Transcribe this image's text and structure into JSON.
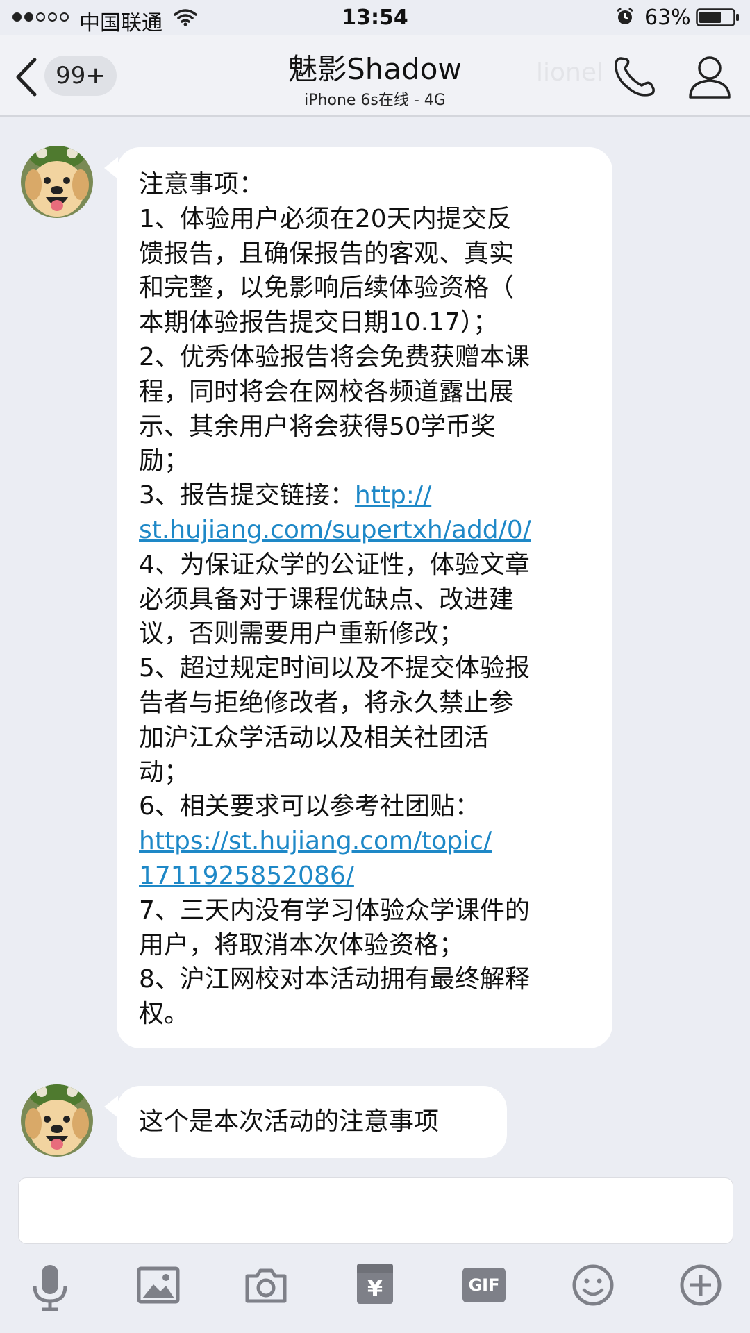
{
  "status_bar": {
    "carrier": "中国联通",
    "time": "13:54",
    "battery": "63%"
  },
  "nav": {
    "unread_count": "99+",
    "title": "魅影Shadow",
    "subtitle": "iPhone 6s在线 - 4G",
    "watermark": "lionel"
  },
  "messages": [
    {
      "lines": [
        {
          "text": "注意事项："
        },
        {
          "text": "1、体验用户必须在20天内提交反"
        },
        {
          "text": "馈报告，且确保报告的客观、真实"
        },
        {
          "text": "和完整，以免影响后续体验资格（"
        },
        {
          "text": "本期体验报告提交日期10.17）；"
        },
        {
          "text": "2、优秀体验报告将会免费获赠本课"
        },
        {
          "text": "程，同时将会在网校各频道露出展"
        },
        {
          "text": "示、其余用户将会获得50学币奖"
        },
        {
          "text": "励；"
        },
        {
          "text": "3、报告提交链接：",
          "link": "http://"
        },
        {
          "link": "st.hujiang.com/supertxh/add/0/"
        },
        {
          "text": "4、为保证众学的公证性，体验文章"
        },
        {
          "text": "必须具备对于课程优缺点、改进建"
        },
        {
          "text": "议，否则需要用户重新修改；"
        },
        {
          "text": "5、超过规定时间以及不提交体验报"
        },
        {
          "text": "告者与拒绝修改者，将永久禁止参"
        },
        {
          "text": "加沪江众学活动以及相关社团活"
        },
        {
          "text": "动；"
        },
        {
          "text": "6、相关要求可以参考社团贴："
        },
        {
          "link": "https://st.hujiang.com/topic/"
        },
        {
          "link": "1711925852086/"
        },
        {
          "text": "7、三天内没有学习体验众学课件的"
        },
        {
          "text": "用户，将取消本次体验资格；"
        },
        {
          "text": "8、沪江网校对本活动拥有最终解释"
        },
        {
          "text": "权。"
        }
      ]
    },
    {
      "lines": [
        {
          "text": "这个是本次活动的注意事项"
        }
      ]
    }
  ],
  "input": {
    "placeholder": ""
  },
  "toolbar": [
    {
      "name": "voice-button",
      "icon": "microphone-icon"
    },
    {
      "name": "image-button",
      "icon": "image-icon"
    },
    {
      "name": "camera-button",
      "icon": "camera-icon"
    },
    {
      "name": "red-packet-button",
      "icon": "red-packet-icon",
      "label": "¥"
    },
    {
      "name": "gif-button",
      "icon": "gif-icon",
      "label": "GIF"
    },
    {
      "name": "emoji-button",
      "icon": "emoji-icon"
    },
    {
      "name": "more-button",
      "icon": "plus-circle-icon"
    }
  ],
  "colors": {
    "background": "#ebedf3",
    "link": "#1e88c7",
    "bubble": "#ffffff",
    "icon": "#7e8088"
  }
}
